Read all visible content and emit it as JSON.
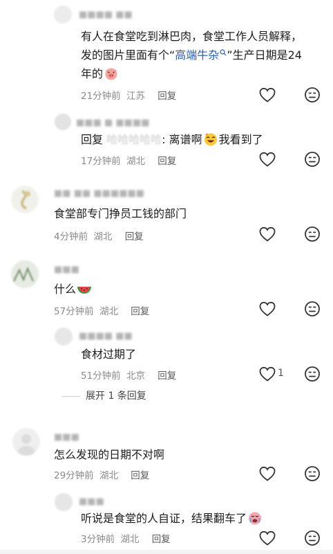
{
  "comments": [
    {
      "text_before_link": "有人在食堂吃到淋巴肉，食堂工作人员解释，发的图片里面有个“",
      "link_text": "高端牛杂",
      "text_after_link": "”生产日期是24年的",
      "time": "21分钟前",
      "location": "江苏",
      "reply_label": "回复"
    },
    {
      "reply_prefix": "回复",
      "reply_to": "哈哈哈哈哈",
      "reply_text_1": ": 离谱啊",
      "reply_text_2": "我看到了",
      "time": "17分钟前",
      "location": "湖北",
      "reply_label": "回复"
    },
    {
      "text": "食堂部专门挣员工钱的部门",
      "time": "4分钟前",
      "location": "湖北",
      "reply_label": "回复"
    },
    {
      "text": "什么",
      "time": "57分钟前",
      "location": "湖北",
      "reply_label": "回复"
    },
    {
      "text": "食材过期了",
      "time": "51分钟前",
      "location": "北京",
      "reply_label": "回复",
      "like_count": "1"
    },
    {
      "text": "怎么发现的日期不对啊",
      "time": "29分钟前",
      "location": "湖北",
      "reply_label": "回复"
    },
    {
      "text": "听说是食堂的人自证，结果翻车了",
      "time": "3分钟前",
      "location": "湖北",
      "reply_label": "回复"
    }
  ],
  "expand_replies": "展开 1 条回复",
  "icons": {
    "like": "heart-outline-icon",
    "dislike": "frown-face-icon",
    "link": "search-link-icon"
  },
  "colors": {
    "link": "#2b5db3",
    "meta": "#8a8a8a",
    "text": "#1c1c1c"
  }
}
